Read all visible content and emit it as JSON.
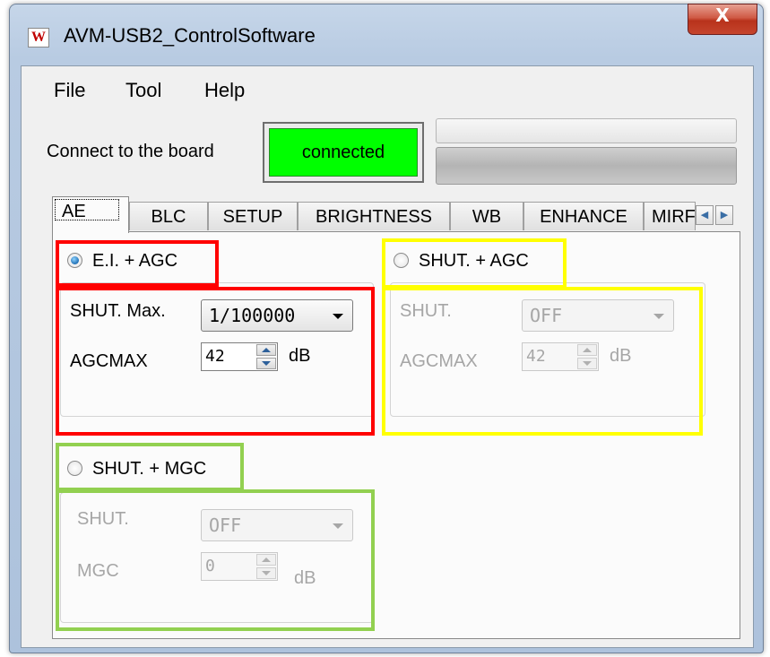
{
  "window": {
    "title": "AVM-USB2_ControlSoftware",
    "app_icon_letter": "W",
    "close_symbol": "X"
  },
  "menu": {
    "items": [
      {
        "label": "File"
      },
      {
        "label": "Tool"
      },
      {
        "label": "Help"
      }
    ]
  },
  "connection": {
    "label": "Connect to the board",
    "status": "connected",
    "status_color": "#00ff00"
  },
  "tabs": [
    {
      "label": "AE",
      "active": true
    },
    {
      "label": "BLC"
    },
    {
      "label": "SETUP"
    },
    {
      "label": "BRIGHTNESS"
    },
    {
      "label": "WB"
    },
    {
      "label": "ENHANCE"
    },
    {
      "label": "MIRF"
    }
  ],
  "tab_scroll": {
    "left": "◀",
    "right": "▶"
  },
  "ae": {
    "ei_agc": {
      "radio_label": "E.I. + AGC",
      "selected": true,
      "shut_max_label": "SHUT. Max.",
      "shut_max_value": "1/100000",
      "agcmax_label": "AGCMAX",
      "agcmax_value": "42",
      "agcmax_unit": "dB"
    },
    "shut_agc": {
      "radio_label": "SHUT. + AGC",
      "selected": false,
      "shut_label": "SHUT.",
      "shut_value": "OFF",
      "agcmax_label": "AGCMAX",
      "agcmax_value": "42",
      "agcmax_unit": "dB"
    },
    "shut_mgc": {
      "radio_label": "SHUT. + MGC",
      "selected": false,
      "shut_label": "SHUT.",
      "shut_value": "OFF",
      "mgc_label": "MGC",
      "mgc_value": "0",
      "mgc_unit": "dB"
    }
  },
  "highlight_colors": {
    "ei_agc": "#ff0000",
    "shut_agc": "#ffff00",
    "shut_mgc": "#92d050"
  }
}
